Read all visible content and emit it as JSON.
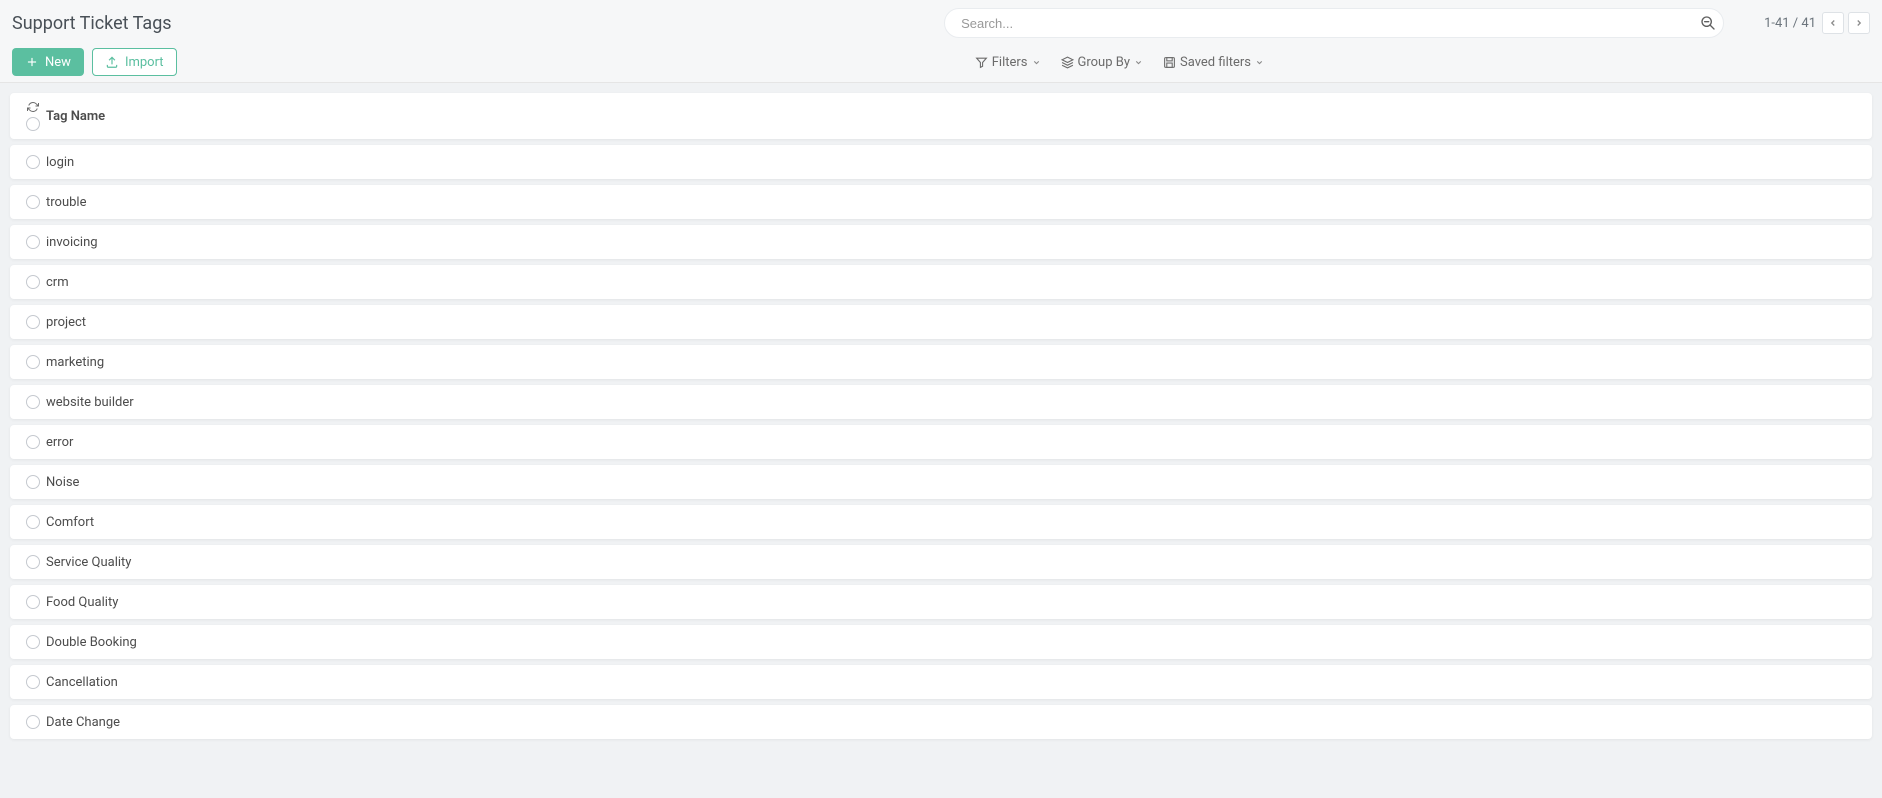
{
  "header": {
    "title": "Support Ticket Tags",
    "search_placeholder": "Search...",
    "pager_text": "1-41 / 41"
  },
  "actions": {
    "new_label": "New",
    "import_label": "Import"
  },
  "filters": {
    "filters_label": "Filters",
    "groupby_label": "Group By",
    "saved_label": "Saved filters"
  },
  "table": {
    "column_header": "Tag Name",
    "rows": [
      {
        "name": "login"
      },
      {
        "name": "trouble"
      },
      {
        "name": "invoicing"
      },
      {
        "name": "crm"
      },
      {
        "name": "project"
      },
      {
        "name": "marketing"
      },
      {
        "name": "website builder"
      },
      {
        "name": "error"
      },
      {
        "name": "Noise"
      },
      {
        "name": "Comfort"
      },
      {
        "name": "Service Quality"
      },
      {
        "name": "Food Quality"
      },
      {
        "name": "Double Booking"
      },
      {
        "name": "Cancellation"
      },
      {
        "name": "Date Change"
      }
    ]
  }
}
